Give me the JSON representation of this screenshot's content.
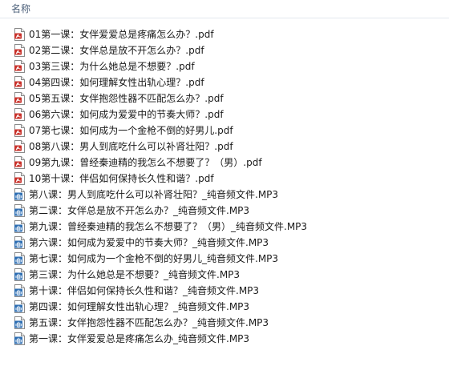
{
  "header": {
    "name_column": "名称"
  },
  "files": [
    {
      "name": "01第一课：女伴爱爱总是疼痛怎么办？.pdf",
      "icon": "pdf-file-icon",
      "type": "pdf"
    },
    {
      "name": "02第二课：女伴总是放不开怎么办？.pdf",
      "icon": "pdf-file-icon",
      "type": "pdf"
    },
    {
      "name": "03第三课：为什么她总是不想要？.pdf",
      "icon": "pdf-file-icon",
      "type": "pdf"
    },
    {
      "name": "04第四课：如何理解女性出轨心理？.pdf",
      "icon": "pdf-file-icon",
      "type": "pdf"
    },
    {
      "name": "05第五课：女伴抱怨性器不匹配怎么办？.pdf",
      "icon": "pdf-file-icon",
      "type": "pdf"
    },
    {
      "name": "06第六课：如何成为爱爱中的节奏大师？.pdf",
      "icon": "pdf-file-icon",
      "type": "pdf"
    },
    {
      "name": "07第七课：如何成为一个金枪不倒的好男儿.pdf",
      "icon": "pdf-file-icon",
      "type": "pdf"
    },
    {
      "name": "08第八课：男人到底吃什么可以补肾壮阳？.pdf",
      "icon": "pdf-file-icon",
      "type": "pdf"
    },
    {
      "name": "09第九课：曾经秦迪精的我怎么不想要了？（男）.pdf",
      "icon": "pdf-file-icon",
      "type": "pdf"
    },
    {
      "name": "10第十课：伴侣如何保持长久性和谐？.pdf",
      "icon": "pdf-file-icon",
      "type": "pdf"
    },
    {
      "name": "第八课：男人到底吃什么可以补肾壮阳？_纯音频文件.MP3",
      "icon": "audio-file-icon",
      "type": "mp3"
    },
    {
      "name": "第二课：女伴总是放不开怎么办？_纯音频文件.MP3",
      "icon": "audio-file-icon",
      "type": "mp3"
    },
    {
      "name": "第九课：曾经秦迪精的我怎么不想要了？（男）_纯音频文件.MP3",
      "icon": "audio-file-icon",
      "type": "mp3"
    },
    {
      "name": "第六课：如何成为爱爱中的节奏大师？_纯音频文件.MP3",
      "icon": "audio-file-icon",
      "type": "mp3"
    },
    {
      "name": "第七课：如何成为一个金枪不倒的好男儿_纯音频文件.MP3",
      "icon": "audio-file-icon",
      "type": "mp3"
    },
    {
      "name": "第三课：为什么她总是不想要？_纯音频文件.MP3",
      "icon": "audio-file-icon",
      "type": "mp3"
    },
    {
      "name": "第十课：伴侣如何保持长久性和谐？_纯音频文件.MP3",
      "icon": "audio-file-icon",
      "type": "mp3"
    },
    {
      "name": "第四课：如何理解女性出轨心理？_纯音频文件.MP3",
      "icon": "audio-file-icon",
      "type": "mp3"
    },
    {
      "name": "第五课：女伴抱怨性器不匹配怎么办？_纯音频文件.MP3",
      "icon": "audio-file-icon",
      "type": "mp3"
    },
    {
      "name": "第一课：女伴爱爱总是疼痛怎么办_纯音频文件.MP3",
      "icon": "audio-file-icon",
      "type": "mp3"
    }
  ],
  "colors": {
    "pdf_icon": "#c8312a",
    "audio_icon": "#2f6fb3",
    "header_text": "#4c607a"
  }
}
